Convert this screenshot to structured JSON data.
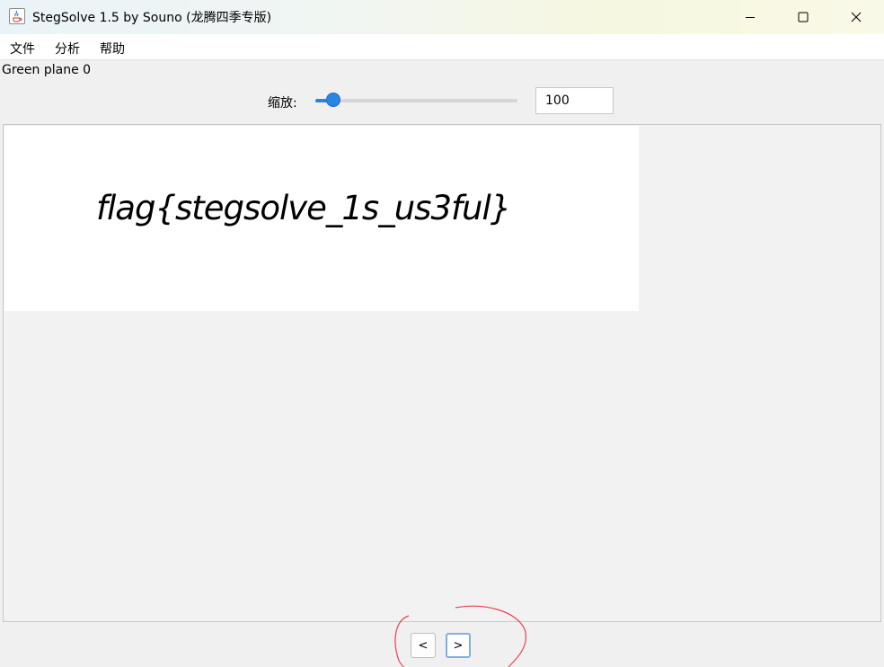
{
  "window": {
    "title": "StegSolve 1.5 by Souno (龙腾四季专版)",
    "minimize_icon": "minimize-icon",
    "maximize_icon": "maximize-icon",
    "close_icon": "close-icon"
  },
  "menu": {
    "items": [
      {
        "label": "文件"
      },
      {
        "label": "分析"
      },
      {
        "label": "帮助"
      }
    ]
  },
  "status": {
    "plane_label": "Green plane 0"
  },
  "zoom": {
    "label": "缩放:",
    "value": "100",
    "slider_fraction": 0.09
  },
  "image": {
    "text": "flag{stegsolve_1s_us3ful}"
  },
  "navigation": {
    "prev_label": "<",
    "next_label": ">"
  },
  "colors": {
    "accent": "#2a84e4",
    "annotation": "#e8424f"
  }
}
